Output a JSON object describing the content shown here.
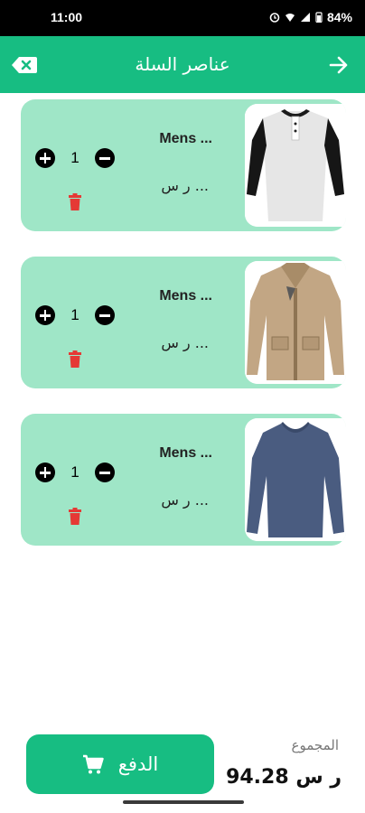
{
  "status_bar": {
    "time": "11:00",
    "battery": "84%",
    "icons": [
      "alarm-icon",
      "wifi-icon",
      "signal-icon",
      "battery-icon"
    ]
  },
  "app_bar": {
    "title": "عناصر السلة",
    "left_icon": "clear-cart-icon",
    "right_icon": "arrow-forward-icon",
    "color": "#17bd82"
  },
  "cart": {
    "items": [
      {
        "name": "Mens ...",
        "price": "ر س ...",
        "quantity": "1",
        "image": "henley-shirt"
      },
      {
        "name": "Mens ...",
        "price": "ر س ...",
        "quantity": "1",
        "image": "beige-jacket"
      },
      {
        "name": "Mens ...",
        "price": "ر س ...",
        "quantity": "1",
        "image": "blue-long-sleeve-tshirt"
      }
    ]
  },
  "footer": {
    "pay_label": "الدفع",
    "total_label": "المجموع",
    "total_value": "ر س 94.28"
  },
  "colors": {
    "accent": "#17bd82",
    "card": "#9fe6c7",
    "delete": "#e53935"
  }
}
